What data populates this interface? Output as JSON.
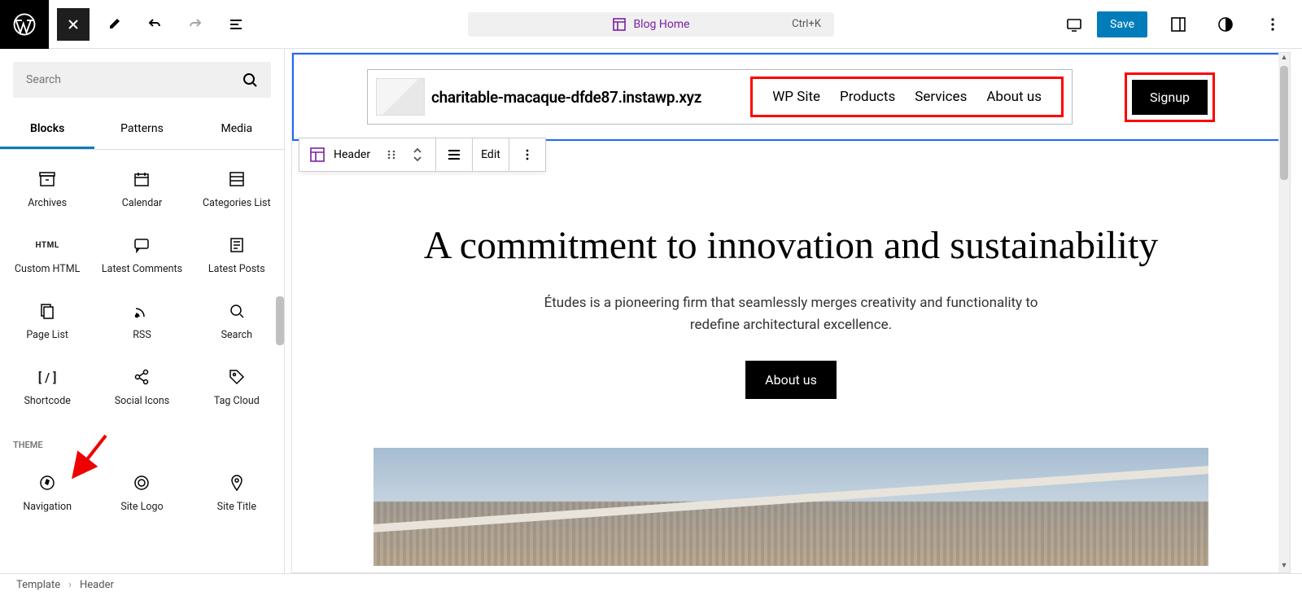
{
  "topbar": {
    "document_title": "Blog Home",
    "shortcut": "Ctrl+K",
    "save_label": "Save"
  },
  "sidebar": {
    "search_placeholder": "Search",
    "tabs": [
      "Blocks",
      "Patterns",
      "Media"
    ],
    "active_tab": 0,
    "widget_blocks": [
      {
        "label": "Archives",
        "icon": "archives"
      },
      {
        "label": "Calendar",
        "icon": "calendar"
      },
      {
        "label": "Categories List",
        "icon": "categories"
      },
      {
        "label": "Custom HTML",
        "icon": "html"
      },
      {
        "label": "Latest Comments",
        "icon": "comments"
      },
      {
        "label": "Latest Posts",
        "icon": "posts"
      },
      {
        "label": "Page List",
        "icon": "pagelist"
      },
      {
        "label": "RSS",
        "icon": "rss"
      },
      {
        "label": "Search",
        "icon": "search"
      },
      {
        "label": "Shortcode",
        "icon": "shortcode"
      },
      {
        "label": "Social Icons",
        "icon": "share"
      },
      {
        "label": "Tag Cloud",
        "icon": "tag"
      }
    ],
    "theme_section_label": "Theme",
    "theme_blocks": [
      {
        "label": "Navigation",
        "icon": "compass"
      },
      {
        "label": "Site Logo",
        "icon": "sitelogo"
      },
      {
        "label": "Site Title",
        "icon": "pin"
      }
    ]
  },
  "floating_toolbar": {
    "block_name": "Header",
    "edit_label": "Edit"
  },
  "header_block": {
    "site_title": "charitable-macaque-dfde87.instawp.xyz",
    "nav": [
      "WP Site",
      "Products",
      "Services",
      "About us"
    ],
    "signup_label": "Signup"
  },
  "hero": {
    "heading": "A commitment to innovation and sustainability",
    "paragraph": "Études is a pioneering firm that seamlessly merges creativity and functionality to redefine architectural excellence.",
    "cta_label": "About us"
  },
  "breadcrumb": {
    "root": "Template",
    "current": "Header"
  }
}
